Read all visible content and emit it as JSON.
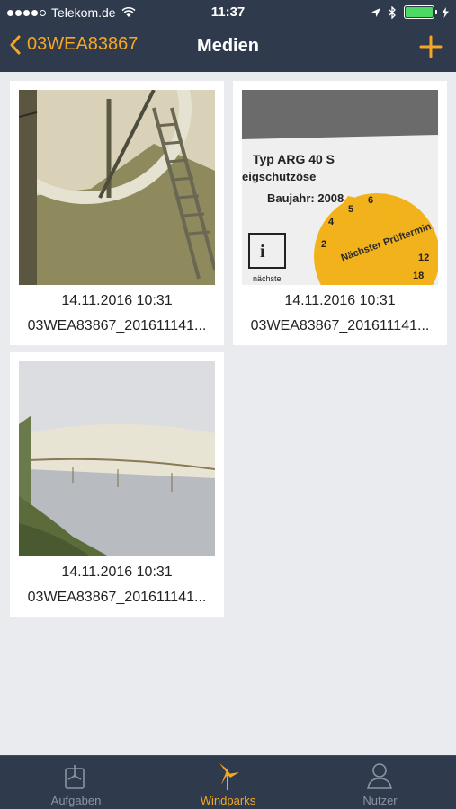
{
  "status_bar": {
    "carrier": "Telekom.de",
    "time": "11:37"
  },
  "navbar": {
    "back_label": "03WEA83867",
    "title": "Medien",
    "add_icon": "plus-icon"
  },
  "media": [
    {
      "date": "14.11.2016 10:31",
      "filename": "03WEA83867_201611141...",
      "thumb": "tower-ladder-photo"
    },
    {
      "date": "14.11.2016 10:31",
      "filename": "03WEA83867_201611141...",
      "thumb": "inspection-label-photo",
      "label_text": {
        "type": "Typ ARG 40 S",
        "sub": "eigschutzöse",
        "year": "Baujahr: 2008",
        "next": "nächste",
        "sticker": "Nächster Prüftermin"
      }
    },
    {
      "date": "14.11.2016 10:31",
      "filename": "03WEA83867_201611141...",
      "thumb": "tower-base-photo"
    }
  ],
  "tabs": [
    {
      "label": "Aufgaben",
      "icon": "tasks-icon",
      "active": false
    },
    {
      "label": "Windparks",
      "icon": "windpark-icon",
      "active": true
    },
    {
      "label": "Nutzer",
      "icon": "user-icon",
      "active": false
    }
  ],
  "colors": {
    "accent": "#f5a623",
    "bar_bg": "#2f3b4c",
    "content_bg": "#e9ebee"
  }
}
